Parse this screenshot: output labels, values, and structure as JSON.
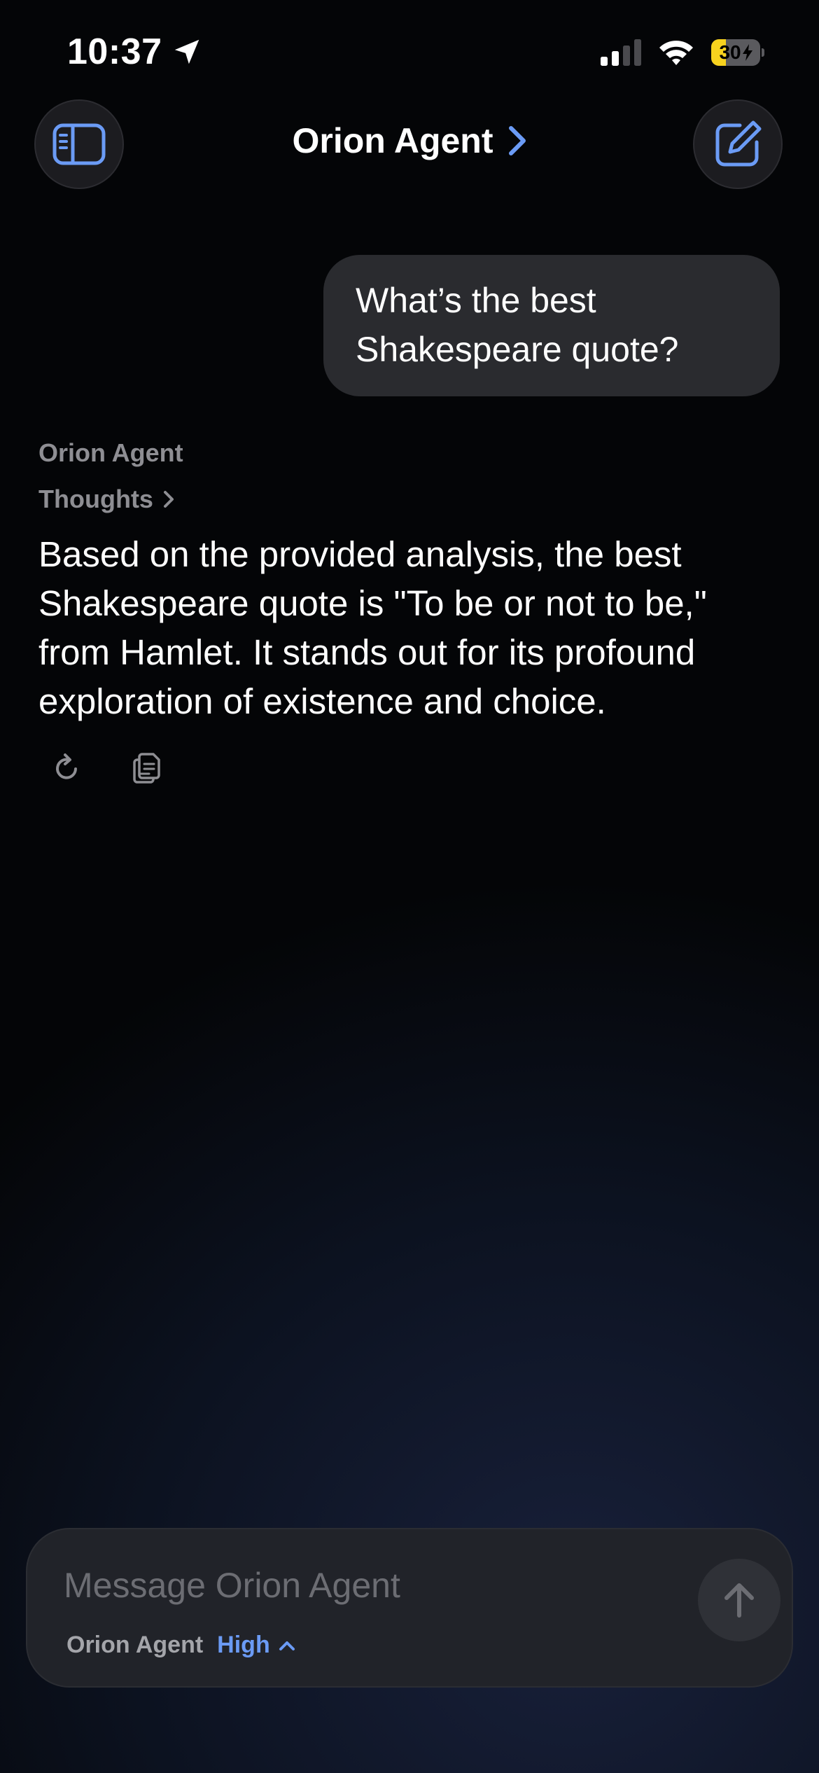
{
  "status_bar": {
    "time": "10:37",
    "battery_percent": "30",
    "battery_level": 30
  },
  "header": {
    "title": "Orion Agent"
  },
  "conversation": {
    "user_message": "What’s the best Shakespeare quote?",
    "agent_name": "Orion Agent",
    "thoughts_label": "Thoughts",
    "response": "Based on the provided analysis, the best Shakespeare quote is \"To be or not to be,\" from Hamlet. It stands out for its profound exploration of existence and choice."
  },
  "composer": {
    "placeholder": "Message Orion Agent",
    "model_name": "Orion Agent",
    "effort_level": "High"
  },
  "colors": {
    "accent": "#6b9bf5",
    "battery_charging": "#f7d21e",
    "bubble": "#2a2b2f"
  }
}
